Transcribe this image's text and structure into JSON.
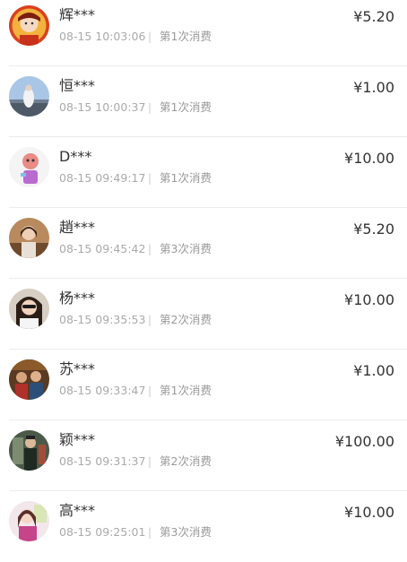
{
  "records": [
    {
      "name": "辉***",
      "time": "08-15 10:03:06",
      "separator": "|",
      "count": "第1次消费",
      "amount": "¥5.20"
    },
    {
      "name": "恒***",
      "time": "08-15 10:00:37",
      "separator": "|",
      "count": "第1次消费",
      "amount": "¥1.00"
    },
    {
      "name": "D***",
      "time": "08-15 09:49:17",
      "separator": "|",
      "count": "第1次消费",
      "amount": "¥10.00"
    },
    {
      "name": "趙***",
      "time": "08-15 09:45:42",
      "separator": "|",
      "count": "第3次消费",
      "amount": "¥5.20"
    },
    {
      "name": "杨***",
      "time": "08-15 09:35:53",
      "separator": "|",
      "count": "第2次消费",
      "amount": "¥10.00"
    },
    {
      "name": "苏***",
      "time": "08-15 09:33:47",
      "separator": "|",
      "count": "第1次消费",
      "amount": "¥1.00"
    },
    {
      "name": "颖***",
      "time": "08-15 09:31:37",
      "separator": "|",
      "count": "第2次消费",
      "amount": "¥100.00"
    },
    {
      "name": "高***",
      "time": "08-15 09:25:01",
      "separator": "|",
      "count": "第3次消费",
      "amount": "¥10.00"
    }
  ]
}
